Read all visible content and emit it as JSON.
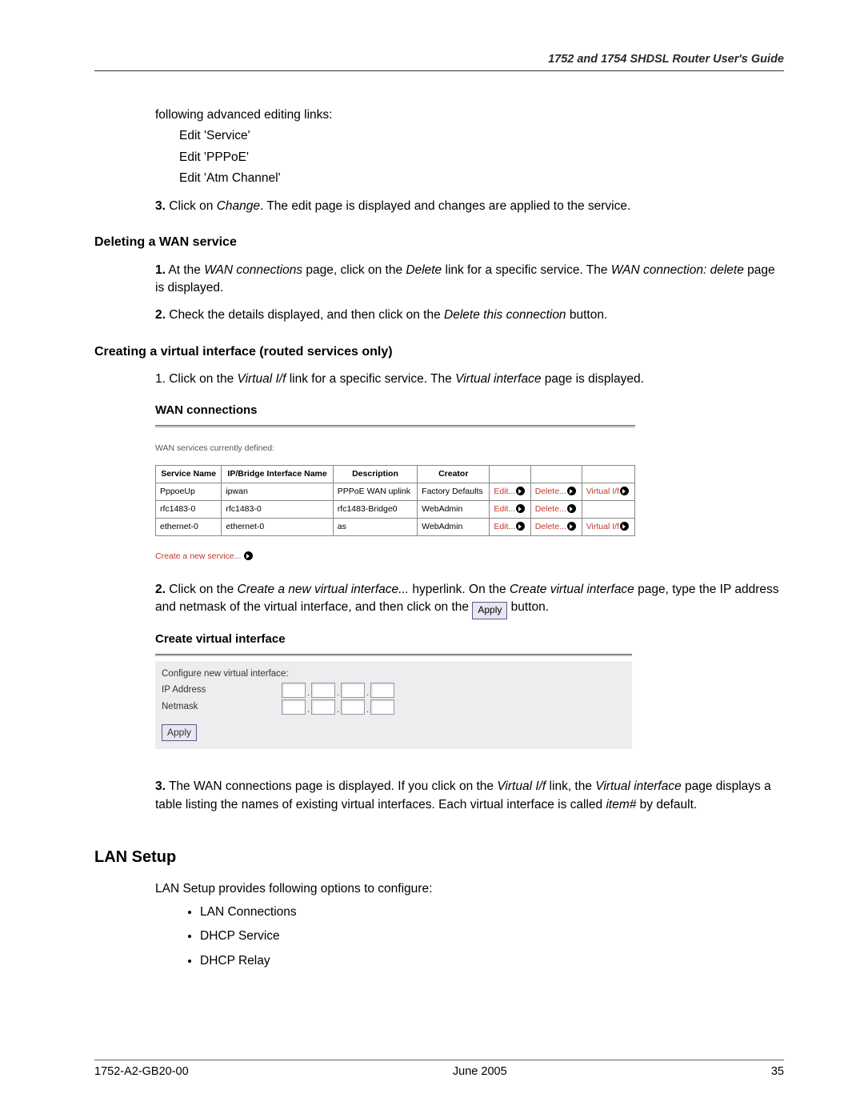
{
  "header": {
    "title": "1752 and 1754 SHDSL Router User's Guide"
  },
  "intro": {
    "line": "following advanced editing links:",
    "links": [
      "Edit 'Service'",
      "Edit 'PPPoE'",
      "Edit 'Atm Channel'"
    ],
    "step3_num": "3.",
    "step3_a": " Click on ",
    "step3_b": "Change",
    "step3_c": ". The edit page is displayed and changes are applied to the service."
  },
  "delete_section": {
    "heading": "Deleting a WAN service",
    "s1_num": "1.",
    "s1_a": " At the ",
    "s1_b": "WAN connections",
    "s1_c": " page, click on the ",
    "s1_d": "Delete",
    "s1_e": " link for a specific service. The ",
    "s1_f": "WAN connection: delete",
    "s1_g": " page is displayed.",
    "s2_num": "2.",
    "s2_a": " Check the details displayed, and then click on the ",
    "s2_b": "Delete this connection",
    "s2_c": " button."
  },
  "virtual_section": {
    "heading": "Creating a virtual interface (routed services only)",
    "s1_a": "1. Click on the ",
    "s1_b": "Virtual I/f",
    "s1_c": " link for a specific service. The ",
    "s1_d": "Virtual interface",
    "s1_e": " page is displayed."
  },
  "wan": {
    "title": "WAN connections",
    "subtitle": "WAN services currently defined:",
    "headers": [
      "Service Name",
      "IP/Bridge Interface Name",
      "Description",
      "Creator"
    ],
    "rows": [
      {
        "svc": "PppoeUp",
        "if": "ipwan",
        "desc": "PPPoE WAN uplink",
        "creator": "Factory Defaults",
        "edit": "Edit...",
        "del": "Delete...",
        "vif": "Virtual I/f"
      },
      {
        "svc": "rfc1483-0",
        "if": "rfc1483-0",
        "desc": "rfc1483-Bridge0",
        "creator": "WebAdmin",
        "edit": "Edit...",
        "del": "Delete...",
        "vif": ""
      },
      {
        "svc": "ethernet-0",
        "if": "ethernet-0",
        "desc": "as",
        "creator": "WebAdmin",
        "edit": "Edit...",
        "del": "Delete...",
        "vif": "Virtual I/f"
      }
    ],
    "create": "Create a new service..."
  },
  "after_wan": {
    "s2_num": "2.",
    "s2_a": " Click on the ",
    "s2_b": "Create a new virtual interface...",
    "s2_c": " hyperlink. On the ",
    "s2_d": "Create virtual interface",
    "s2_e": " page, type the IP address and netmask of the virtual interface, and then click on the ",
    "apply_label": "Apply",
    "s2_f": " button."
  },
  "cvi": {
    "title": "Create virtual interface",
    "config_line": "Configure new virtual interface:",
    "ip_label": "IP Address",
    "netmask_label": "Netmask",
    "apply": "Apply"
  },
  "after_cvi": {
    "s3_num": "3.",
    "s3_a": " The WAN connections page is displayed. If you click on the ",
    "s3_b": "Virtual I/f",
    "s3_c": " link, the ",
    "s3_d": "Virtual interface",
    "s3_e": " page displays a table listing the names of existing virtual interfaces. Each virtual interface is called ",
    "s3_f": "item#",
    "s3_g": " by default."
  },
  "lan": {
    "heading": "LAN Setup",
    "intro": "LAN Setup provides following options to configure:",
    "items": [
      "LAN Connections",
      "DHCP Service",
      "DHCP Relay"
    ]
  },
  "footer": {
    "left": "1752-A2-GB20-00",
    "center": "June 2005",
    "right": "35"
  }
}
